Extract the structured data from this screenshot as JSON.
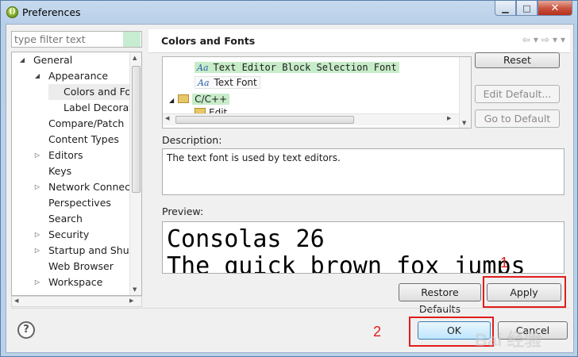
{
  "window": {
    "title": "Preferences",
    "app_icon_glyph": "()"
  },
  "caption_buttons": {
    "minimize": "▁",
    "maximize": "□",
    "close": "✕"
  },
  "filter": {
    "placeholder": "type filter text"
  },
  "tree": [
    {
      "label": "General",
      "twisty": "◢",
      "indent": 0,
      "expanded": true
    },
    {
      "label": "Appearance",
      "twisty": "◢",
      "indent": 1,
      "expanded": true
    },
    {
      "label": "Colors and Fonts",
      "twisty": "",
      "indent": 2,
      "selected": true
    },
    {
      "label": "Label Decorations",
      "twisty": "",
      "indent": 2
    },
    {
      "label": "Compare/Patch",
      "twisty": "",
      "indent": 1
    },
    {
      "label": "Content Types",
      "twisty": "",
      "indent": 1
    },
    {
      "label": "Editors",
      "twisty": "▷",
      "indent": 1
    },
    {
      "label": "Keys",
      "twisty": "",
      "indent": 1
    },
    {
      "label": "Network Connections",
      "twisty": "▷",
      "indent": 1
    },
    {
      "label": "Perspectives",
      "twisty": "",
      "indent": 1
    },
    {
      "label": "Search",
      "twisty": "",
      "indent": 1
    },
    {
      "label": "Security",
      "twisty": "▷",
      "indent": 1
    },
    {
      "label": "Startup and Shutdown",
      "twisty": "▷",
      "indent": 1
    },
    {
      "label": "Web Browser",
      "twisty": "",
      "indent": 1
    },
    {
      "label": "Workspace",
      "twisty": "▷",
      "indent": 1
    }
  ],
  "page": {
    "title": "Colors and Fonts",
    "nav": {
      "back": "⇦",
      "dropdown": "▾",
      "forward": "⇨",
      "menu": "▾"
    }
  },
  "font_tree": [
    {
      "label": "Text Editor Block Selection Font",
      "icon": "Aa",
      "mono": true,
      "highlight": true
    },
    {
      "label": "Text Font",
      "icon": "Aa",
      "mono": false,
      "highlight": false
    },
    {
      "label": "C/C++",
      "icon": "folder",
      "twisty": "◢",
      "highlight": true
    },
    {
      "label": "Edit",
      "icon": "folder",
      "highlight": false
    }
  ],
  "buttons": {
    "reset": "Reset",
    "edit_default": "Edit Default...",
    "go_to_default": "Go to Default",
    "restore_defaults": "Restore Defaults",
    "apply": "Apply",
    "ok": "OK",
    "cancel": "Cancel",
    "help": "?"
  },
  "description": {
    "label": "Description:",
    "text": "The text font is used by text editors."
  },
  "preview": {
    "label": "Preview:",
    "line1": "Consolas 26",
    "line2": "The quick brown fox jumps"
  },
  "annotations": {
    "apply_number": "1",
    "ok_number": "2"
  },
  "watermark": "Bai 经验",
  "colors": {
    "highlight": "#c7ecc9",
    "annotation": "#e11c1c",
    "accent": "#3c7fb1"
  }
}
